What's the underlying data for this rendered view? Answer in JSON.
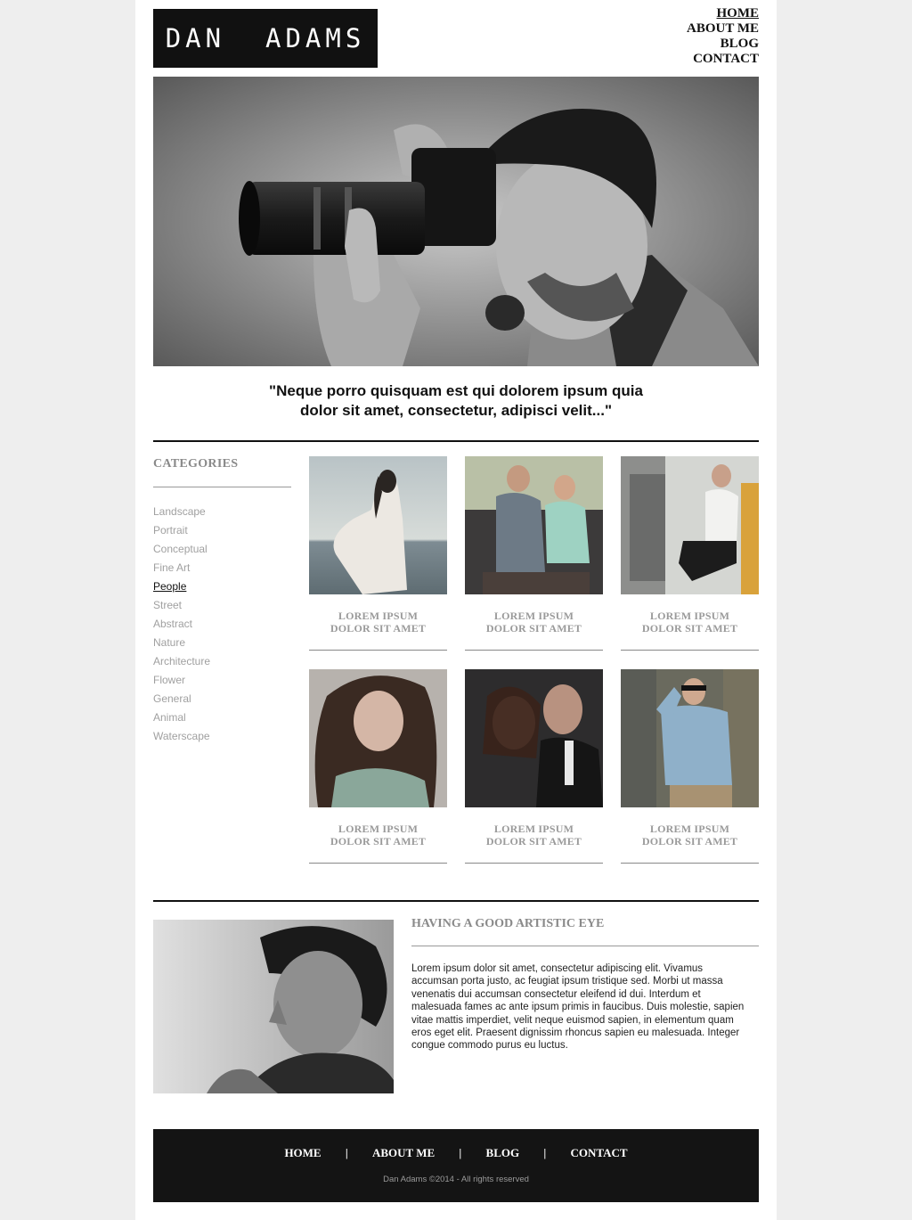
{
  "header": {
    "logo": "DAN  ADAMS",
    "nav": [
      "HOME",
      "ABOUT ME",
      "BLOG",
      "CONTACT"
    ],
    "active_nav": "HOME"
  },
  "hero": {
    "image": "photographer-with-camera-photo",
    "quote_line1": "\"Neque porro quisquam est qui dolorem ipsum quia",
    "quote_line2": "dolor sit amet, consectetur, adipisci velit...\""
  },
  "sidebar": {
    "title": "CATEGORIES",
    "items": [
      "Landscape",
      "Portrait",
      "Conceptual",
      "Fine Art",
      "People",
      "Street",
      "Abstract",
      "Nature",
      "Architecture",
      "Flower",
      "General",
      "Animal",
      "Waterscape"
    ],
    "active": "People"
  },
  "gallery": {
    "tiles": [
      {
        "line1": "LOREM IPSUM",
        "line2": "DOLOR SIT AMET",
        "image": "woman-white-dress-seaside-photo"
      },
      {
        "line1": "LOREM IPSUM",
        "line2": "DOLOR SIT AMET",
        "image": "couple-on-motorcycle-photo"
      },
      {
        "line1": "LOREM IPSUM",
        "line2": "DOLOR SIT AMET",
        "image": "man-in-car-sunglasses-photo"
      },
      {
        "line1": "LOREM IPSUM",
        "line2": "DOLOR SIT AMET",
        "image": "woman-portrait-long-hair-photo"
      },
      {
        "line1": "LOREM IPSUM",
        "line2": "DOLOR SIT AMET",
        "image": "couple-embracing-photo"
      },
      {
        "line1": "LOREM IPSUM",
        "line2": "DOLOR SIT AMET",
        "image": "man-denim-jacket-photo"
      }
    ]
  },
  "about": {
    "image": "man-portrait-bw-photo",
    "title": "HAVING A GOOD ARTISTIC EYE",
    "lines": [
      "Lorem ipsum dolor sit amet, consectetur adipiscing elit. Vivamus",
      "accumsan porta justo, ac feugiat ipsum tristique sed. Morbi ut massa",
      "venenatis dui accumsan consectetur eleifend id dui. Interdum et",
      "malesuada fames ac ante ipsum primis in faucibus. Duis molestie, sapien",
      "vitae mattis imperdiet, velit neque euismod sapien, in elementum quam",
      "eros eget elit. Praesent dignissim rhoncus sapien eu malesuada. Integer",
      "congue commodo purus eu luctus."
    ]
  },
  "footer": {
    "nav": [
      "HOME",
      "ABOUT ME",
      "BLOG",
      "CONTACT"
    ],
    "separator": "|",
    "copyright": "Dan Adams ©2014 - All rights reserved"
  },
  "colors": {
    "page_bg": "#eeeeee",
    "content_bg": "#ffffff",
    "logo_bg": "#111111",
    "footer_bg": "#141414",
    "muted_text": "#9a9a9a"
  }
}
